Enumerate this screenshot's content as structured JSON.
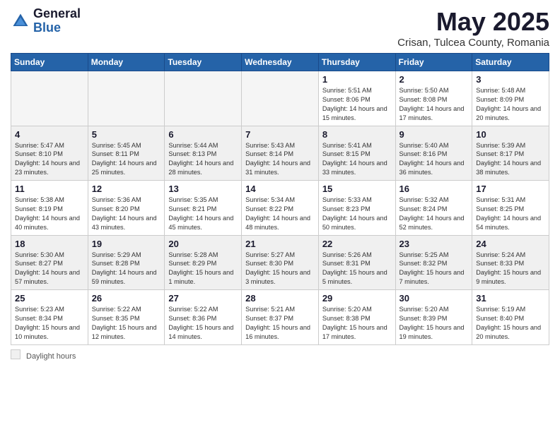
{
  "header": {
    "logo_general": "General",
    "logo_blue": "Blue",
    "month_title": "May 2025",
    "subtitle": "Crisan, Tulcea County, Romania"
  },
  "weekdays": [
    "Sunday",
    "Monday",
    "Tuesday",
    "Wednesday",
    "Thursday",
    "Friday",
    "Saturday"
  ],
  "footer": {
    "daylight_label": "Daylight hours"
  },
  "weeks": [
    [
      {
        "day": "",
        "info": "",
        "empty": true
      },
      {
        "day": "",
        "info": "",
        "empty": true
      },
      {
        "day": "",
        "info": "",
        "empty": true
      },
      {
        "day": "",
        "info": "",
        "empty": true
      },
      {
        "day": "1",
        "info": "Sunrise: 5:51 AM\nSunset: 8:06 PM\nDaylight: 14 hours\nand 15 minutes.",
        "empty": false
      },
      {
        "day": "2",
        "info": "Sunrise: 5:50 AM\nSunset: 8:08 PM\nDaylight: 14 hours\nand 17 minutes.",
        "empty": false
      },
      {
        "day": "3",
        "info": "Sunrise: 5:48 AM\nSunset: 8:09 PM\nDaylight: 14 hours\nand 20 minutes.",
        "empty": false
      }
    ],
    [
      {
        "day": "4",
        "info": "Sunrise: 5:47 AM\nSunset: 8:10 PM\nDaylight: 14 hours\nand 23 minutes.",
        "empty": false
      },
      {
        "day": "5",
        "info": "Sunrise: 5:45 AM\nSunset: 8:11 PM\nDaylight: 14 hours\nand 25 minutes.",
        "empty": false
      },
      {
        "day": "6",
        "info": "Sunrise: 5:44 AM\nSunset: 8:13 PM\nDaylight: 14 hours\nand 28 minutes.",
        "empty": false
      },
      {
        "day": "7",
        "info": "Sunrise: 5:43 AM\nSunset: 8:14 PM\nDaylight: 14 hours\nand 31 minutes.",
        "empty": false
      },
      {
        "day": "8",
        "info": "Sunrise: 5:41 AM\nSunset: 8:15 PM\nDaylight: 14 hours\nand 33 minutes.",
        "empty": false
      },
      {
        "day": "9",
        "info": "Sunrise: 5:40 AM\nSunset: 8:16 PM\nDaylight: 14 hours\nand 36 minutes.",
        "empty": false
      },
      {
        "day": "10",
        "info": "Sunrise: 5:39 AM\nSunset: 8:17 PM\nDaylight: 14 hours\nand 38 minutes.",
        "empty": false
      }
    ],
    [
      {
        "day": "11",
        "info": "Sunrise: 5:38 AM\nSunset: 8:19 PM\nDaylight: 14 hours\nand 40 minutes.",
        "empty": false
      },
      {
        "day": "12",
        "info": "Sunrise: 5:36 AM\nSunset: 8:20 PM\nDaylight: 14 hours\nand 43 minutes.",
        "empty": false
      },
      {
        "day": "13",
        "info": "Sunrise: 5:35 AM\nSunset: 8:21 PM\nDaylight: 14 hours\nand 45 minutes.",
        "empty": false
      },
      {
        "day": "14",
        "info": "Sunrise: 5:34 AM\nSunset: 8:22 PM\nDaylight: 14 hours\nand 48 minutes.",
        "empty": false
      },
      {
        "day": "15",
        "info": "Sunrise: 5:33 AM\nSunset: 8:23 PM\nDaylight: 14 hours\nand 50 minutes.",
        "empty": false
      },
      {
        "day": "16",
        "info": "Sunrise: 5:32 AM\nSunset: 8:24 PM\nDaylight: 14 hours\nand 52 minutes.",
        "empty": false
      },
      {
        "day": "17",
        "info": "Sunrise: 5:31 AM\nSunset: 8:25 PM\nDaylight: 14 hours\nand 54 minutes.",
        "empty": false
      }
    ],
    [
      {
        "day": "18",
        "info": "Sunrise: 5:30 AM\nSunset: 8:27 PM\nDaylight: 14 hours\nand 57 minutes.",
        "empty": false
      },
      {
        "day": "19",
        "info": "Sunrise: 5:29 AM\nSunset: 8:28 PM\nDaylight: 14 hours\nand 59 minutes.",
        "empty": false
      },
      {
        "day": "20",
        "info": "Sunrise: 5:28 AM\nSunset: 8:29 PM\nDaylight: 15 hours\nand 1 minute.",
        "empty": false
      },
      {
        "day": "21",
        "info": "Sunrise: 5:27 AM\nSunset: 8:30 PM\nDaylight: 15 hours\nand 3 minutes.",
        "empty": false
      },
      {
        "day": "22",
        "info": "Sunrise: 5:26 AM\nSunset: 8:31 PM\nDaylight: 15 hours\nand 5 minutes.",
        "empty": false
      },
      {
        "day": "23",
        "info": "Sunrise: 5:25 AM\nSunset: 8:32 PM\nDaylight: 15 hours\nand 7 minutes.",
        "empty": false
      },
      {
        "day": "24",
        "info": "Sunrise: 5:24 AM\nSunset: 8:33 PM\nDaylight: 15 hours\nand 9 minutes.",
        "empty": false
      }
    ],
    [
      {
        "day": "25",
        "info": "Sunrise: 5:23 AM\nSunset: 8:34 PM\nDaylight: 15 hours\nand 10 minutes.",
        "empty": false
      },
      {
        "day": "26",
        "info": "Sunrise: 5:22 AM\nSunset: 8:35 PM\nDaylight: 15 hours\nand 12 minutes.",
        "empty": false
      },
      {
        "day": "27",
        "info": "Sunrise: 5:22 AM\nSunset: 8:36 PM\nDaylight: 15 hours\nand 14 minutes.",
        "empty": false
      },
      {
        "day": "28",
        "info": "Sunrise: 5:21 AM\nSunset: 8:37 PM\nDaylight: 15 hours\nand 16 minutes.",
        "empty": false
      },
      {
        "day": "29",
        "info": "Sunrise: 5:20 AM\nSunset: 8:38 PM\nDaylight: 15 hours\nand 17 minutes.",
        "empty": false
      },
      {
        "day": "30",
        "info": "Sunrise: 5:20 AM\nSunset: 8:39 PM\nDaylight: 15 hours\nand 19 minutes.",
        "empty": false
      },
      {
        "day": "31",
        "info": "Sunrise: 5:19 AM\nSunset: 8:40 PM\nDaylight: 15 hours\nand 20 minutes.",
        "empty": false
      }
    ]
  ]
}
